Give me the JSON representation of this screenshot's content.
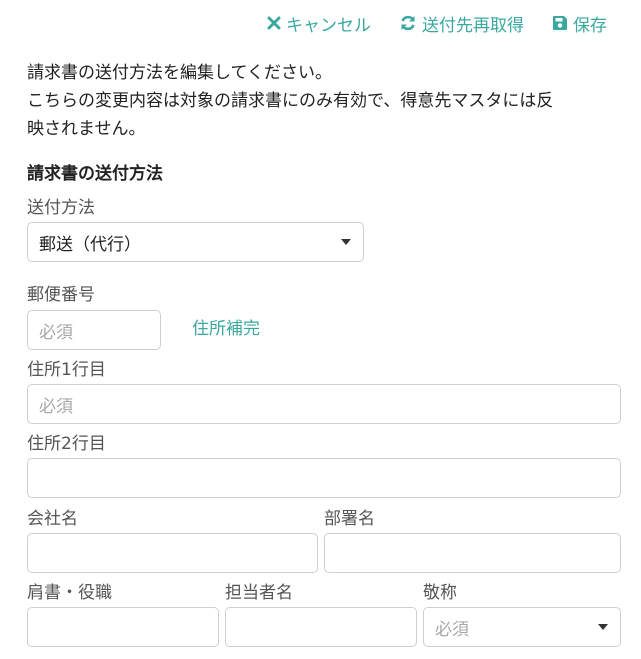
{
  "toolbar": {
    "cancel_label": "キャンセル",
    "refresh_label": "送付先再取得",
    "save_label": "保存"
  },
  "intro": {
    "line1": "請求書の送付方法を編集してください。",
    "line2": "こちらの変更内容は対象の請求書にのみ有効で、得意先マスタには反",
    "line3": "映されません。"
  },
  "section": {
    "title": "請求書の送付方法"
  },
  "form": {
    "delivery_method": {
      "label": "送付方法",
      "value": "郵送（代行）"
    },
    "postal_code": {
      "label": "郵便番号",
      "placeholder": "必須",
      "address_fill_label": "住所補完"
    },
    "address1": {
      "label": "住所1行目",
      "placeholder": "必須"
    },
    "address2": {
      "label": "住所2行目",
      "placeholder": ""
    },
    "company": {
      "label": "会社名",
      "placeholder": ""
    },
    "department": {
      "label": "部署名",
      "placeholder": ""
    },
    "title": {
      "label": "肩書・役職",
      "placeholder": ""
    },
    "person": {
      "label": "担当者名",
      "placeholder": ""
    },
    "honorific": {
      "label": "敬称",
      "placeholder": "必須"
    }
  },
  "colors": {
    "accent": "#3ba8a0",
    "border": "#cfcfcf",
    "placeholder": "#a8a8a8"
  }
}
